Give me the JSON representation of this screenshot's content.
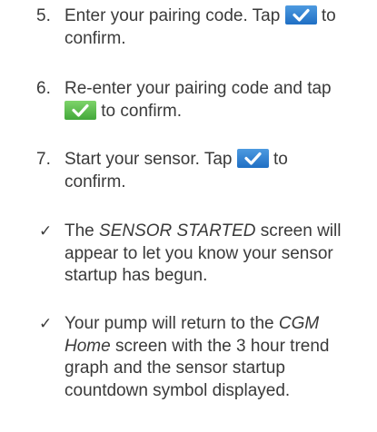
{
  "steps": [
    {
      "number": "5.",
      "line1_before": "Enter your pairing code. Tap ",
      "line1_after": " to",
      "line2": "confirm.",
      "button": {
        "icon": "check-icon",
        "color": "#2f80d2"
      }
    },
    {
      "number": "6.",
      "line1": "Re-enter your pairing code and tap",
      "line2_after": " to confirm.",
      "button": {
        "icon": "check-icon",
        "color": "#5cbf4e"
      }
    },
    {
      "number": "7.",
      "line1_before": "Start your sensor. Tap ",
      "line1_after": " to",
      "line2": "confirm.",
      "button": {
        "icon": "check-icon",
        "color": "#2f80d2"
      }
    }
  ],
  "results": [
    {
      "marker": "✓",
      "line1_before": "The ",
      "line1_italic": "SENSOR STARTED",
      "line1_after": " screen will",
      "line2": "appear to let you know your sensor",
      "line3": "startup has begun."
    },
    {
      "marker": "✓",
      "line1_before": "Your pump will return to the ",
      "line1_italic": "CGM",
      "line2_italic": "Home",
      "line2_after": " screen with the 3 hour trend",
      "line3": "graph and the sensor startup",
      "line4": "countdown symbol displayed."
    }
  ]
}
